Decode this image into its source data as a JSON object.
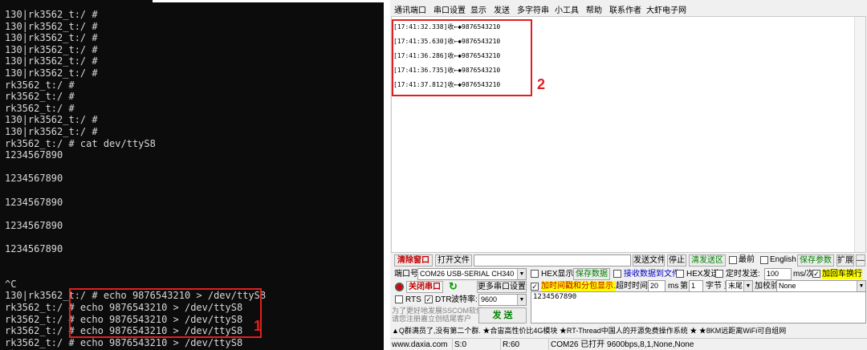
{
  "terminal": {
    "lines": [
      "130|rk3562_t:/ #",
      "130|rk3562_t:/ #",
      "130|rk3562_t:/ #",
      "130|rk3562_t:/ #",
      "130|rk3562_t:/ #",
      "130|rk3562_t:/ #",
      "rk3562_t:/ #",
      "rk3562_t:/ #",
      "rk3562_t:/ #",
      "130|rk3562_t:/ #",
      "130|rk3562_t:/ #",
      "rk3562_t:/ # cat dev/ttyS8",
      "1234567890",
      "",
      "1234567890",
      "",
      "1234567890",
      "",
      "1234567890",
      "",
      "1234567890",
      "",
      "",
      "^C",
      "130|rk3562_t:/ # echo 9876543210 > /dev/ttyS8",
      "rk3562_t:/ # echo 9876543210 > /dev/ttyS8",
      "rk3562_t:/ # echo 9876543210 > /dev/ttyS8",
      "rk3562_t:/ # echo 9876543210 > /dev/ttyS8",
      "rk3562_t:/ # echo 9876543210 > /dev/ttyS8",
      "rk3562_t:/ #"
    ],
    "annotation": "1"
  },
  "sscom": {
    "menu": [
      "通讯端口",
      "串口设置",
      "显示",
      "发送",
      "多字符串",
      "小工具",
      "帮助",
      "联系作者",
      "大虾电子网"
    ],
    "rx_lines": [
      "[17:41:32.338]收←◆9876543210",
      "[17:41:35.630]收←◆9876543210",
      "[17:41:36.286]收←◆9876543210",
      "[17:41:36.735]收←◆9876543210",
      "[17:41:37.812]收←◆9876543210"
    ],
    "annotation": "2",
    "toolbar": {
      "clear_window": "清除窗口",
      "open_file": "打开文件",
      "send_file": "发送文件",
      "stop": "停止",
      "clear_send": "清发送区",
      "topmost": "最前",
      "english": "English",
      "save_params": "保存参数",
      "expand": "扩展",
      "collapse": "—"
    },
    "port": {
      "port_label": "端口号",
      "port_value": "COM26 USB-SERIAL CH340",
      "hex_display": "HEX显示",
      "save_data": "保存数据",
      "recv_to_file": "接收数据到文件",
      "hex_send": "HEX发送",
      "timed_send": "定时发送:",
      "interval_value": "100",
      "interval_unit": "ms/次",
      "append_newline": "加回车换行",
      "close_port": "关闭串口",
      "more_settings": "更多串口设置",
      "timestamp_split": "加时间戳和分包显示.",
      "timeout_label": "超时时间:",
      "timeout_value": "20",
      "timeout_unit": "ms",
      "nth_label": "第",
      "nth_value": "1",
      "byte_label": "字节 至",
      "end_value": "末尾",
      "checksum_label": "加校验",
      "checksum_value": "None",
      "rts": "RTS",
      "dtr": "DTR",
      "baud_label": "波特率:",
      "baud_value": "9600",
      "send": "发 送",
      "promo_text": "为了更好地发展SSCOM软件\n请您注册嘉立创结尾客户",
      "tx_content": "1234567890"
    },
    "ad_text": "▲Q群满员了,没有第二个群. ★合宙高性价比4G模块 ★RT-Thread中国人的开源免费操作系统 ★ ★8KM远距离WiFi可自组网",
    "status": {
      "site": "www.daxia.com",
      "sent": "S:0",
      "received": "R:60",
      "port_status": "COM26 已打开  9600bps,8,1,None,None"
    }
  }
}
